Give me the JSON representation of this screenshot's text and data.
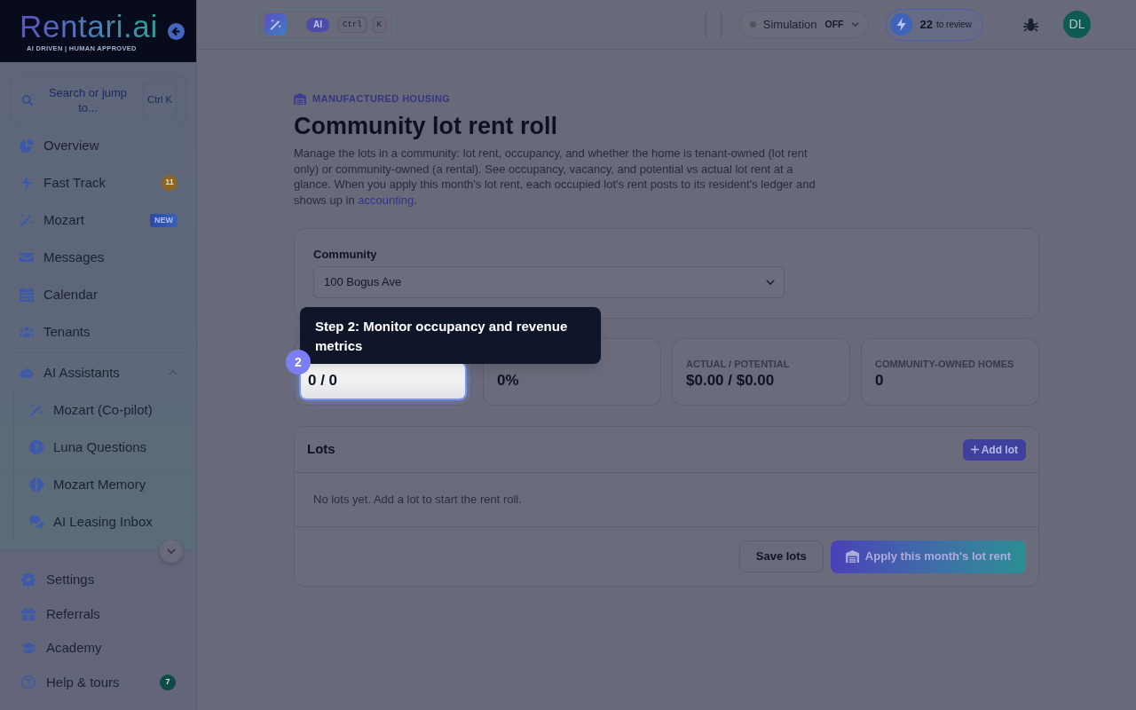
{
  "sidebar": {
    "logo": {
      "text": "Rentari.ai",
      "tagline": "AI DRIVEN | HUMAN APPROVED"
    },
    "search": {
      "placeholder": "Search or jump to...",
      "shortcut": "Ctrl K"
    },
    "nav": [
      {
        "label": "Overview"
      },
      {
        "label": "Fast Track",
        "badge": {
          "kind": "count",
          "text": "11",
          "color": "#8e6521"
        }
      },
      {
        "label": "Mozart",
        "badge": {
          "kind": "tag",
          "text": "NEW"
        }
      },
      {
        "label": "Messages"
      },
      {
        "label": "Calendar"
      },
      {
        "label": "Tenants"
      }
    ],
    "assistants": {
      "label": "AI Assistants",
      "expanded": true,
      "children": [
        {
          "label": "Mozart (Co-pilot)"
        },
        {
          "label": "Luna Questions"
        },
        {
          "label": "Mozart Memory"
        },
        {
          "label": "AI Leasing Inbox"
        }
      ]
    },
    "footer_nav": [
      {
        "label": "Settings"
      },
      {
        "label": "Referrals"
      },
      {
        "label": "Academy"
      },
      {
        "label": "Help & tours",
        "badge": {
          "kind": "count",
          "text": "7",
          "color": "#0d4b47"
        }
      }
    ]
  },
  "topbar": {
    "command": {
      "badge": "AI",
      "keys": [
        "Ctrl",
        "K"
      ]
    },
    "simulation": {
      "label": "Simulation",
      "value": "OFF",
      "on": false
    },
    "review": {
      "count": "22",
      "label": "to review"
    },
    "avatar": {
      "initials": "DL"
    }
  },
  "page": {
    "eyebrow": "MANUFACTURED HOUSING",
    "title": "Community lot rent roll",
    "description": {
      "text": "Manage the lots in a community: lot rent, occupancy, and whether the home is tenant-owned (lot rent only) or community-owned (a rental). See occupancy, vacancy, and potential vs actual lot rent at a glance. When you apply this month's lot rent, each occupied lot's rent posts to its resident's ledger and shows up in ",
      "link": "accounting",
      "after": "."
    }
  },
  "community": {
    "label": "Community",
    "value": "100 Bogus Ave"
  },
  "stats": [
    {
      "value": "0 / 0",
      "highlighted": true
    },
    {
      "value": "0%",
      "highlighted": false
    },
    {
      "label": "ACTUAL / POTENTIAL",
      "value": "$0.00 / $0.00",
      "highlighted": false
    },
    {
      "label": "COMMUNITY-OWNED HOMES",
      "value": "0",
      "highlighted": false
    }
  ],
  "tour": {
    "step": "2",
    "text": "Step 2: Monitor occupancy and revenue metrics"
  },
  "lots": {
    "title": "Lots",
    "add_button": "Add lot",
    "empty_text": "No lots yet. Add a lot to start the rent roll.",
    "actions": [
      {
        "label": "Save lots",
        "kind": "secondary",
        "disabled": false
      },
      {
        "label": "Apply this month's lot rent",
        "kind": "primary",
        "disabled": true
      }
    ]
  }
}
